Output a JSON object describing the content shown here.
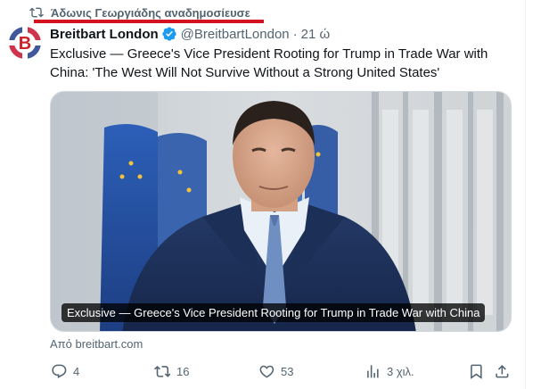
{
  "repost": {
    "icon": "repost-icon",
    "text": "Άδωνις Γεωργιάδης αναδημοσίευσε"
  },
  "tweet": {
    "author_name": "Breitbart London",
    "verified_icon": "verified-badge-icon",
    "handle": "@BreitbartLondon",
    "separator": "·",
    "time": "21 ώ",
    "text": "Exclusive — Greece's Vice President Rooting for Trump in Trade War with China: 'The West Will Not Survive Without a Strong United States'",
    "avatar_letter": "B"
  },
  "card": {
    "caption": "Exclusive — Greece's Vice President Rooting for Trump in Trade War with China",
    "source": "Από breitbart.com"
  },
  "actions": {
    "reply_count": "4",
    "repost_count": "16",
    "like_count": "53",
    "views_count": "3 χιλ."
  },
  "colors": {
    "text": "#0f1419",
    "secondary": "#536471",
    "verified": "#1d9bf0",
    "highlight_underline": "#d4111f",
    "brand": "#cc2229"
  }
}
